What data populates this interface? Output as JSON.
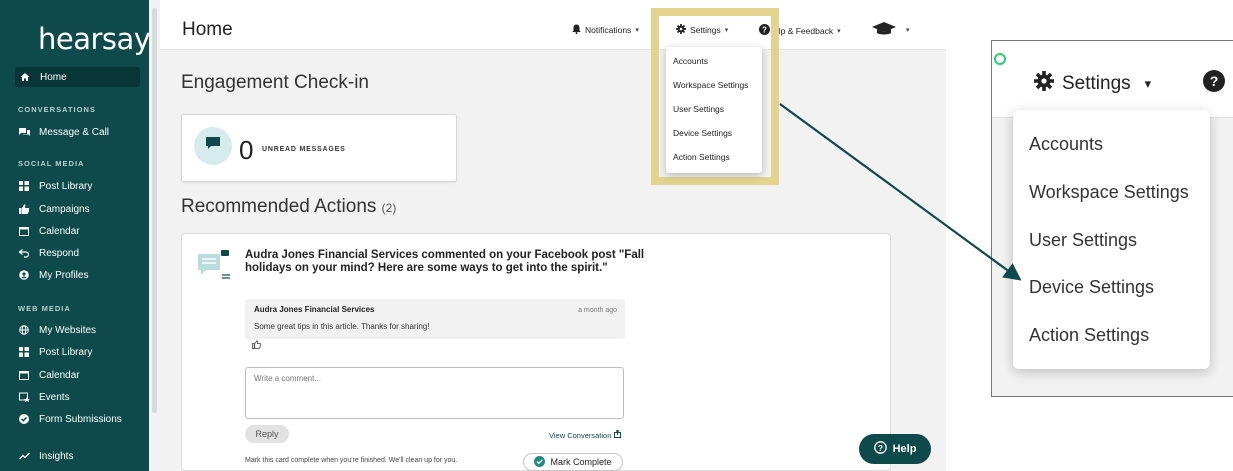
{
  "sidebar": {
    "logo": "hearsay",
    "home": "Home",
    "sections": {
      "conversations": "CONVERSATIONS",
      "social": "SOCIAL MEDIA",
      "web": "WEB MEDIA"
    },
    "items": {
      "message_call": "Message & Call",
      "post_library": "Post Library",
      "campaigns": "Campaigns",
      "calendar": "Calendar",
      "respond": "Respond",
      "my_profiles": "My Profiles",
      "my_websites": "My Websites",
      "web_post_library": "Post Library",
      "web_calendar": "Calendar",
      "events": "Events",
      "form_submissions": "Form Submissions",
      "insights": "Insights"
    }
  },
  "header": {
    "title": "Home",
    "notifications": "Notifications",
    "settings": "Settings",
    "help": "elp & Feedback"
  },
  "settings_menu": [
    "Accounts",
    "Workspace Settings",
    "User Settings",
    "Device Settings",
    "Action Settings"
  ],
  "engagement": {
    "title": "Engagement Check-in",
    "unread_count": "0",
    "unread_label": "UNREAD MESSAGES"
  },
  "recommended": {
    "title": "Recommended Actions",
    "count": "(2)",
    "headline": "Audra Jones Financial Services commented on your Facebook post \"Fall holidays on your mind? Here are some ways to get into the spirit.\"",
    "comment_author": "Audra Jones Financial Services",
    "comment_time": "a month ago",
    "comment_text": "Some great tips in this article. Thanks for sharing!",
    "input_placeholder": "Write a comment...",
    "reply": "Reply",
    "view_conversation": "View Conversation",
    "mark_hint": "Mark this card complete when you're finished. We'll clean up for you.",
    "mark_complete": "Mark Complete"
  },
  "help_button": "Help",
  "zoom": {
    "settings": "Settings",
    "menu": [
      "Accounts",
      "Workspace Settings",
      "User Settings",
      "Device Settings",
      "Action Settings"
    ]
  },
  "colors": {
    "brand_teal": "#0e4a4c",
    "highlight": "#e2d48f",
    "arrow": "#0e4a4c"
  }
}
